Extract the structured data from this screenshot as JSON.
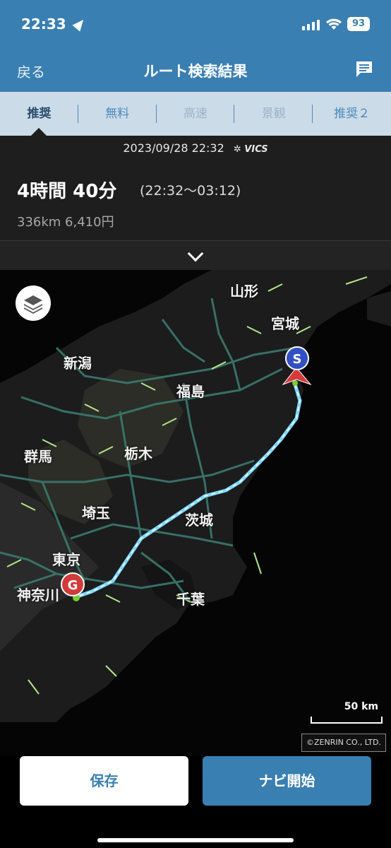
{
  "status_bar": {
    "time": "22:33",
    "battery": "93"
  },
  "header": {
    "back_label": "戻る",
    "title": "ルート検索結果"
  },
  "tabs": [
    {
      "label": "推奨",
      "state": "active"
    },
    {
      "label": "無料",
      "state": "normal"
    },
    {
      "label": "高速",
      "state": "disabled"
    },
    {
      "label": "景観",
      "state": "disabled"
    },
    {
      "label": "推奨２",
      "state": "normal"
    }
  ],
  "route": {
    "datetime": "2023/09/28 22:32",
    "vics": "VICS",
    "duration": "4時間 40分",
    "time_span": "(22:32～03:12)",
    "distance_cost": "336km  6,410円"
  },
  "map": {
    "prefectures": [
      "山形",
      "宮城",
      "新潟",
      "福島",
      "群馬",
      "栃木",
      "埼玉",
      "茨城",
      "東京",
      "神奈川",
      "千葉"
    ],
    "start_marker": "S",
    "goal_marker": "G",
    "scale_label": "50 km",
    "copyright": "©ZENRIN CO., LTD."
  },
  "actions": {
    "save_label": "保存",
    "start_label": "ナビ開始"
  },
  "colors": {
    "accent": "#3a7fb1",
    "route": "#7fd6ff",
    "road": "#3a7a6e",
    "expressway": "#b5e68a"
  }
}
